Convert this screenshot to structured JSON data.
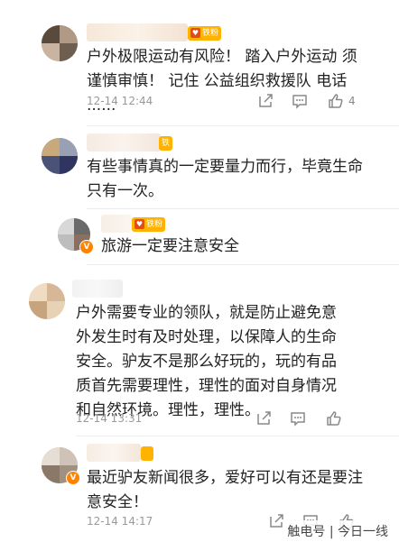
{
  "comments": [
    {
      "fan_label": "铁粉",
      "text": "户外极限运动有风险！ 踏入户外运动 须 谨慎审慎！ 记住 公益组织救援队 电话 ......",
      "time": "12-14 12:44",
      "likes": "4"
    },
    {
      "fan_label": "铁",
      "text": "有些事情真的一定要量力而行，毕竟生命只有一次。"
    },
    {
      "fan_label": "铁粉",
      "text": "旅游一定要注意安全"
    },
    {
      "text": "户外需要专业的领队，就是防止避免意外发生时有及时处理，以保障人的生命安全。驴友不是那么好玩的，玩的有品质首先需要理性，理性的面对自身情况和自然环境。理性，理性。",
      "time": "12-14 13:31"
    },
    {
      "text": "最近驴友新闻很多，爱好可以有还是要注意安全！",
      "time": "12-14 14:17"
    }
  ],
  "watermark": "触电号 | 今日一线",
  "icons": {
    "share": "share-icon",
    "comment": "comment-icon",
    "like": "like-icon"
  }
}
